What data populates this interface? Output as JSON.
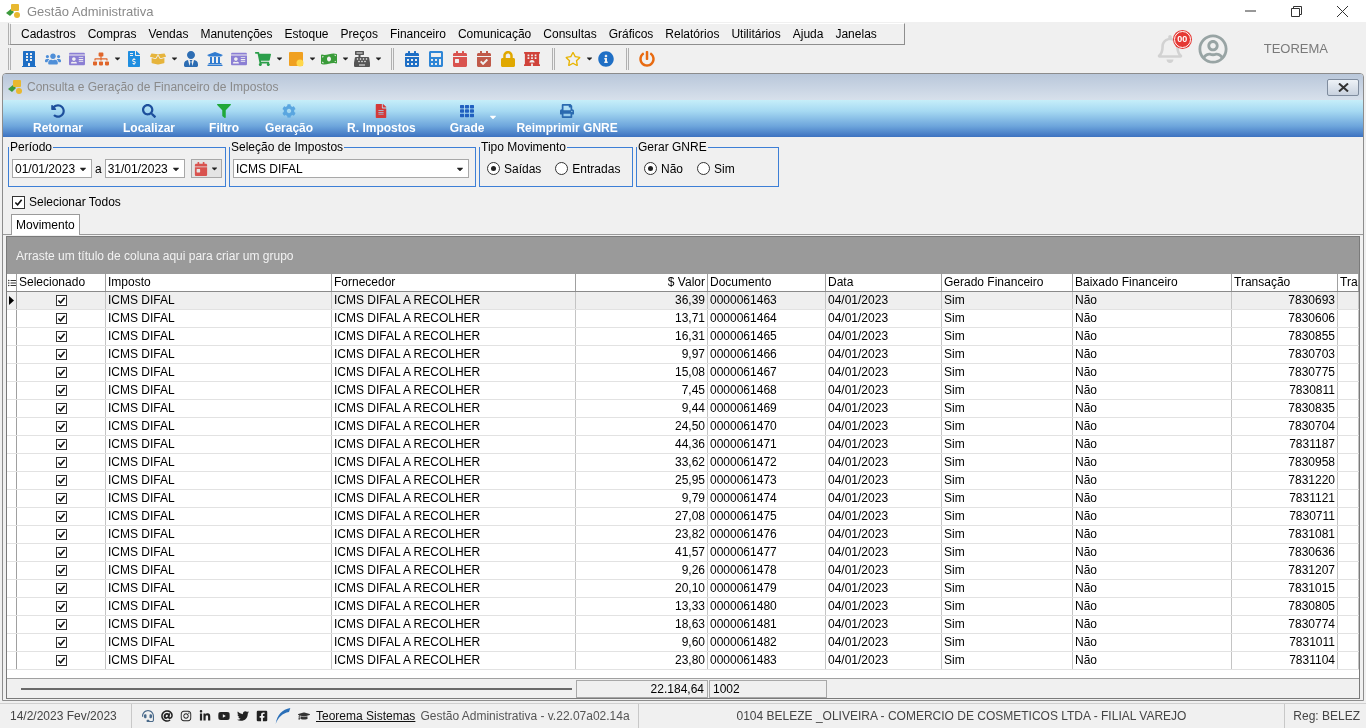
{
  "window": {
    "title": "Gestão Administrativa"
  },
  "menu": [
    "Cadastros",
    "Compras",
    "Vendas",
    "Manutenções",
    "Estoque",
    "Preços",
    "Financeiro",
    "Comunicação",
    "Consultas",
    "Gráficos",
    "Relatórios",
    "Utilitários",
    "Ajuda",
    "Janelas"
  ],
  "header": {
    "notifications": "00",
    "user": "TEOREMA"
  },
  "child_window": {
    "title": "Consulta e Geração de Financeiro de Impostos"
  },
  "ribbon": [
    {
      "label": "Retornar",
      "dropdown": false
    },
    {
      "label": "Localizar",
      "dropdown": false
    },
    {
      "label": "Filtro",
      "dropdown": false
    },
    {
      "label": "Geração",
      "dropdown": false
    },
    {
      "label": "R. Impostos",
      "dropdown": false
    },
    {
      "label": "Grade",
      "dropdown": true
    },
    {
      "label": "Reimprimir GNRE",
      "dropdown": false
    }
  ],
  "filters": {
    "periodo": {
      "label": "Período",
      "from": "01/01/2023",
      "separator": "a",
      "to": "31/01/2023"
    },
    "impostos": {
      "label": "Seleção de Impostos",
      "value": "ICMS DIFAL"
    },
    "tipo_movimento": {
      "label": "Tipo Movimento",
      "options": [
        {
          "label": "Saídas",
          "selected": true
        },
        {
          "label": "Entradas",
          "selected": false
        }
      ]
    },
    "gerar_gnre": {
      "label": "Gerar GNRE",
      "options": [
        {
          "label": "Não",
          "selected": true
        },
        {
          "label": "Sim",
          "selected": false
        }
      ]
    }
  },
  "select_all": {
    "label": "Selecionar Todos",
    "checked": true
  },
  "tabs": [
    {
      "label": "Movimento",
      "selected": true
    }
  ],
  "group_panel": {
    "hint": "Arraste um título de coluna aqui para criar um grupo"
  },
  "table": {
    "columns": [
      "Selecionado",
      "Imposto",
      "Fornecedor",
      "$ Valor",
      "Documento",
      "Data",
      "Gerado Financeiro",
      "Baixado Financeiro",
      "Transação",
      "Tra"
    ],
    "rows": [
      {
        "selected": true,
        "checked": true,
        "cells": [
          "",
          "ICMS DIFAL",
          "ICMS DIFAL A RECOLHER",
          "36,39",
          "0000061463",
          "04/01/2023",
          "Sim",
          "Não",
          "7830693"
        ]
      },
      {
        "selected": false,
        "checked": true,
        "cells": [
          "",
          "ICMS DIFAL",
          "ICMS DIFAL A RECOLHER",
          "13,71",
          "0000061464",
          "04/01/2023",
          "Sim",
          "Não",
          "7830606"
        ]
      },
      {
        "selected": false,
        "checked": true,
        "cells": [
          "",
          "ICMS DIFAL",
          "ICMS DIFAL A RECOLHER",
          "16,31",
          "0000061465",
          "04/01/2023",
          "Sim",
          "Não",
          "7830855"
        ]
      },
      {
        "selected": false,
        "checked": true,
        "cells": [
          "",
          "ICMS DIFAL",
          "ICMS DIFAL A RECOLHER",
          "9,97",
          "0000061466",
          "04/01/2023",
          "Sim",
          "Não",
          "7830703"
        ]
      },
      {
        "selected": false,
        "checked": true,
        "cells": [
          "",
          "ICMS DIFAL",
          "ICMS DIFAL A RECOLHER",
          "15,08",
          "0000061467",
          "04/01/2023",
          "Sim",
          "Não",
          "7830775"
        ]
      },
      {
        "selected": false,
        "checked": true,
        "cells": [
          "",
          "ICMS DIFAL",
          "ICMS DIFAL A RECOLHER",
          "7,45",
          "0000061468",
          "04/01/2023",
          "Sim",
          "Não",
          "7830811"
        ]
      },
      {
        "selected": false,
        "checked": true,
        "cells": [
          "",
          "ICMS DIFAL",
          "ICMS DIFAL A RECOLHER",
          "9,44",
          "0000061469",
          "04/01/2023",
          "Sim",
          "Não",
          "7830835"
        ]
      },
      {
        "selected": false,
        "checked": true,
        "cells": [
          "",
          "ICMS DIFAL",
          "ICMS DIFAL A RECOLHER",
          "24,50",
          "0000061470",
          "04/01/2023",
          "Sim",
          "Não",
          "7830704"
        ]
      },
      {
        "selected": false,
        "checked": true,
        "cells": [
          "",
          "ICMS DIFAL",
          "ICMS DIFAL A RECOLHER",
          "44,36",
          "0000061471",
          "04/01/2023",
          "Sim",
          "Não",
          "7831187"
        ]
      },
      {
        "selected": false,
        "checked": true,
        "cells": [
          "",
          "ICMS DIFAL",
          "ICMS DIFAL A RECOLHER",
          "33,62",
          "0000061472",
          "04/01/2023",
          "Sim",
          "Não",
          "7830958"
        ]
      },
      {
        "selected": false,
        "checked": true,
        "cells": [
          "",
          "ICMS DIFAL",
          "ICMS DIFAL A RECOLHER",
          "25,95",
          "0000061473",
          "04/01/2023",
          "Sim",
          "Não",
          "7831220"
        ]
      },
      {
        "selected": false,
        "checked": true,
        "cells": [
          "",
          "ICMS DIFAL",
          "ICMS DIFAL A RECOLHER",
          "9,79",
          "0000061474",
          "04/01/2023",
          "Sim",
          "Não",
          "7831121"
        ]
      },
      {
        "selected": false,
        "checked": true,
        "cells": [
          "",
          "ICMS DIFAL",
          "ICMS DIFAL A RECOLHER",
          "27,08",
          "0000061475",
          "04/01/2023",
          "Sim",
          "Não",
          "7830711"
        ]
      },
      {
        "selected": false,
        "checked": true,
        "cells": [
          "",
          "ICMS DIFAL",
          "ICMS DIFAL A RECOLHER",
          "23,82",
          "0000061476",
          "04/01/2023",
          "Sim",
          "Não",
          "7831081"
        ]
      },
      {
        "selected": false,
        "checked": true,
        "cells": [
          "",
          "ICMS DIFAL",
          "ICMS DIFAL A RECOLHER",
          "41,57",
          "0000061477",
          "04/01/2023",
          "Sim",
          "Não",
          "7830636"
        ]
      },
      {
        "selected": false,
        "checked": true,
        "cells": [
          "",
          "ICMS DIFAL",
          "ICMS DIFAL A RECOLHER",
          "9,26",
          "0000061478",
          "04/01/2023",
          "Sim",
          "Não",
          "7831207"
        ]
      },
      {
        "selected": false,
        "checked": true,
        "cells": [
          "",
          "ICMS DIFAL",
          "ICMS DIFAL A RECOLHER",
          "20,10",
          "0000061479",
          "04/01/2023",
          "Sim",
          "Não",
          "7831015"
        ]
      },
      {
        "selected": false,
        "checked": true,
        "cells": [
          "",
          "ICMS DIFAL",
          "ICMS DIFAL A RECOLHER",
          "13,33",
          "0000061480",
          "04/01/2023",
          "Sim",
          "Não",
          "7830805"
        ]
      },
      {
        "selected": false,
        "checked": true,
        "cells": [
          "",
          "ICMS DIFAL",
          "ICMS DIFAL A RECOLHER",
          "18,63",
          "0000061481",
          "04/01/2023",
          "Sim",
          "Não",
          "7830774"
        ]
      },
      {
        "selected": false,
        "checked": true,
        "cells": [
          "",
          "ICMS DIFAL",
          "ICMS DIFAL A RECOLHER",
          "9,60",
          "0000061482",
          "04/01/2023",
          "Sim",
          "Não",
          "7831011"
        ]
      },
      {
        "selected": false,
        "checked": true,
        "cells": [
          "",
          "ICMS DIFAL",
          "ICMS DIFAL A RECOLHER",
          "23,80",
          "0000061483",
          "04/01/2023",
          "Sim",
          "Não",
          "7831104"
        ]
      }
    ]
  },
  "totals": {
    "valor": "22.184,64",
    "count": "1002"
  },
  "status_bar": {
    "date": "14/2/2023 Fev/2023",
    "link": "Teorema Sistemas",
    "version": "Gestão Administrativa - v.22.07a02.14a",
    "company": "0104 BELEZE _OLIVEIRA - COMERCIO DE COSMETICOS LTDA - FILIAL VAREJO",
    "register": "Reg: BELEZ"
  }
}
